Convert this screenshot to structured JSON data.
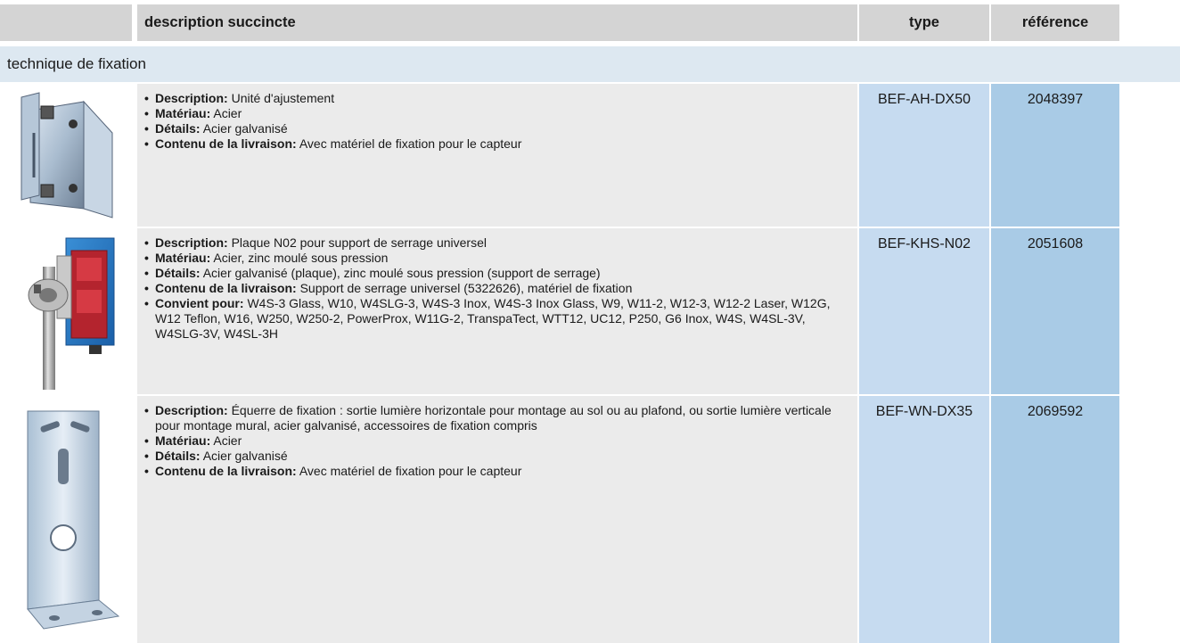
{
  "header": {
    "description": "description succincte",
    "type": "type",
    "reference": "référence"
  },
  "section": {
    "title": "technique de fixation"
  },
  "rows": [
    {
      "image_icon": "adjustment-unit-bracket-icon",
      "type": "BEF-AH-DX50",
      "reference": "2048397",
      "items": [
        {
          "label": "Description:",
          "value": "Unité d'ajustement"
        },
        {
          "label": "Matériau:",
          "value": "Acier"
        },
        {
          "label": "Détails:",
          "value": "Acier galvanisé"
        },
        {
          "label": "Contenu de la livraison:",
          "value": "Avec matériel de fixation pour le capteur"
        }
      ]
    },
    {
      "image_icon": "clamp-holder-plate-icon",
      "type": "BEF-KHS-N02",
      "reference": "2051608",
      "items": [
        {
          "label": "Description:",
          "value": "Plaque N02 pour support de serrage universel"
        },
        {
          "label": "Matériau:",
          "value": "Acier, zinc moulé sous pression"
        },
        {
          "label": "Détails:",
          "value": "Acier galvanisé (plaque), zinc moulé sous pression (support de serrage)"
        },
        {
          "label": "Contenu de la livraison:",
          "value": "Support de serrage universel (5322626), matériel de fixation"
        },
        {
          "label": "Convient pour:",
          "value": "W4S-3 Glass, W10, W4SLG-3, W4S-3 Inox, W4S-3 Inox Glass, W9, W11-2, W12-3, W12-2 Laser, W12G, W12 Teflon, W16, W250, W250-2, PowerProx, W11G-2, TranspaTect, WTT12, UC12, P250, G6 Inox, W4S, W4SL-3V, W4SLG-3V, W4SL-3H"
        }
      ]
    },
    {
      "image_icon": "mounting-bracket-icon",
      "type": "BEF-WN-DX35",
      "reference": "2069592",
      "items": [
        {
          "label": "Description:",
          "value": "Équerre de fixation : sortie lumière horizontale pour montage au sol ou au plafond, ou sortie lumière verticale pour montage mural, acier galvanisé, accessoires de fixation compris"
        },
        {
          "label": "Matériau:",
          "value": "Acier"
        },
        {
          "label": "Détails:",
          "value": "Acier galvanisé"
        },
        {
          "label": "Contenu de la livraison:",
          "value": "Avec matériel de fixation pour le capteur"
        }
      ]
    }
  ]
}
